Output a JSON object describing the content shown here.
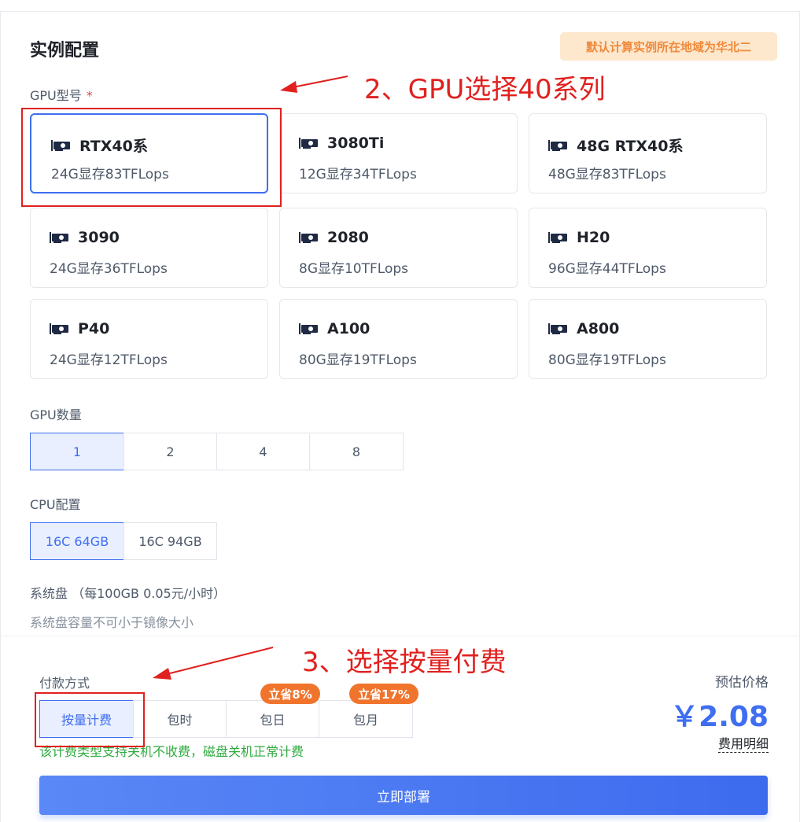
{
  "section_title": "实例配置",
  "region_tag": "默认计算实例所在地域为华北二",
  "gpu_model": {
    "label": "GPU型号",
    "required_mark": "*",
    "cards": [
      {
        "name": "RTX40系",
        "spec": "24G显存83TFLops",
        "selected": true
      },
      {
        "name": "3080Ti",
        "spec": "12G显存34TFLops"
      },
      {
        "name": "48G RTX40系",
        "spec": "48G显存83TFLops"
      },
      {
        "name": "3090",
        "spec": "24G显存36TFLops"
      },
      {
        "name": "2080",
        "spec": "8G显存10TFLops"
      },
      {
        "name": "H20",
        "spec": "96G显存44TFLops"
      },
      {
        "name": "P40",
        "spec": "24G显存12TFLops"
      },
      {
        "name": "A100",
        "spec": "80G显存19TFLops"
      },
      {
        "name": "A800",
        "spec": "80G显存19TFLops"
      }
    ]
  },
  "gpu_count": {
    "label": "GPU数量",
    "options": [
      "1",
      "2",
      "4",
      "8"
    ],
    "selected": "1"
  },
  "cpu_config": {
    "label": "CPU配置",
    "options": [
      "16C 64GB",
      "16C 94GB"
    ],
    "selected": "16C 64GB"
  },
  "system_disk": {
    "label": "系统盘 （每100GB 0.05元/小时）",
    "hint": "系统盘容量不可小于镜像大小"
  },
  "payment": {
    "label": "付款方式",
    "options": [
      "按量计费",
      "包时",
      "包日",
      "包月"
    ],
    "selected": "按量计费",
    "badges": {
      "daily": "立省8%",
      "monthly": "立省17%"
    },
    "note": "该计费类型支持关机不收费，磁盘关机正常计费"
  },
  "price": {
    "label": "预估价格",
    "value": "￥2.08",
    "detail_link": "费用明细"
  },
  "deploy_button": "立即部署",
  "annotations": {
    "step2": "2、GPU选择40系列",
    "step3": "3、选择按量付费"
  },
  "colors": {
    "accent": "#3f6ef0",
    "annotation_red": "#e0211f",
    "badge_orange": "#f0742c",
    "note_green": "#2faa3f",
    "region_tag_bg": "#fde7cd"
  }
}
